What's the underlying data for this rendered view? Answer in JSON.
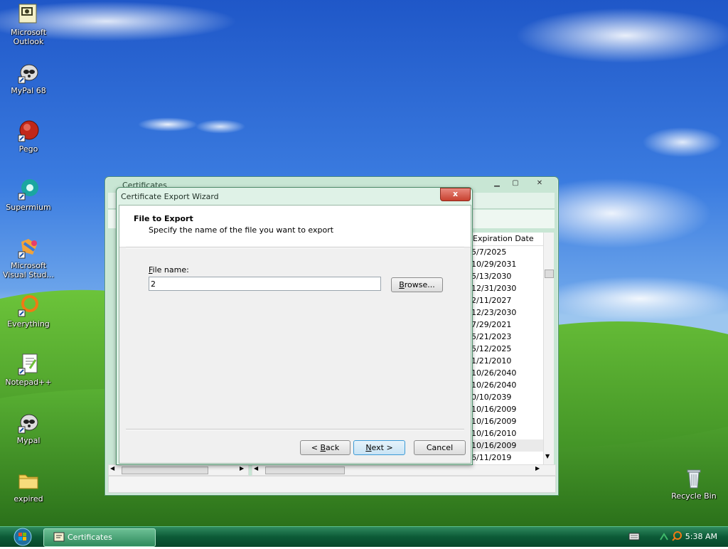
{
  "desktop": {
    "icons": [
      {
        "label": "Microsoft Outlook",
        "icon": "outlook-icon"
      },
      {
        "label": "MyPal 68",
        "icon": "mypal-icon"
      },
      {
        "label": "Pego",
        "icon": "pego-icon"
      },
      {
        "label": "Supermium",
        "icon": "supermium-icon"
      },
      {
        "label": "Microsoft Visual Stud...",
        "icon": "visual-studio-icon"
      },
      {
        "label": "Everything",
        "icon": "everything-icon"
      },
      {
        "label": "Notepad++",
        "icon": "notepadpp-icon"
      },
      {
        "label": "Mypal",
        "icon": "mypal-icon"
      },
      {
        "label": "expired",
        "icon": "folder-icon"
      },
      {
        "label": "Recycle Bin",
        "icon": "recycle-bin-icon"
      }
    ]
  },
  "cert_window": {
    "title": "Certificates",
    "column_header": "Expiration Date",
    "expiration_dates": [
      "5/7/2025",
      "10/29/2031",
      "5/13/2030",
      "12/31/2030",
      "2/11/2027",
      "12/23/2030",
      "7/29/2021",
      "5/21/2023",
      "5/12/2025",
      "1/21/2010",
      "10/26/2040",
      "10/26/2040",
      "0/10/2039",
      "10/16/2009",
      "10/16/2009",
      "10/16/2010",
      "10/16/2009",
      "6/11/2019"
    ]
  },
  "wizard": {
    "title": "Certificate Export Wizard",
    "close_label": "x",
    "heading": "File to Export",
    "subheading": "Specify the name of the file you want to export",
    "file_name_label": "File name:",
    "file_name_value": "2",
    "browse_label": "Browse...",
    "back_label": "< Back",
    "next_label": "Next >",
    "cancel_label": "Cancel"
  },
  "taskbar": {
    "task_label": "Certificates",
    "clock": "5:38 AM"
  },
  "colors": {
    "accent": "#2f8a5e",
    "sky": "#3b7ce0",
    "grass": "#4aa82a"
  }
}
